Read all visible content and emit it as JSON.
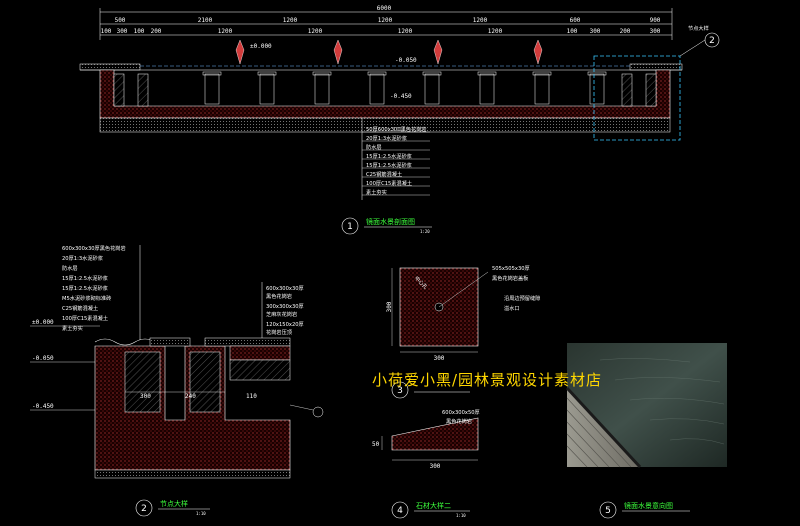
{
  "colors": {
    "background": "#000000",
    "line": "#ffffff",
    "title": "#3cff3c",
    "watermark": "#ffd700",
    "hatch": "#d23c3c",
    "highlight": "#38c8ff"
  },
  "section1": {
    "total_dim": "6000",
    "top_dims": [
      "500",
      "2100",
      "1200",
      "1200",
      "1200",
      "600",
      "900"
    ],
    "detail_dims": [
      "100",
      "300",
      "100",
      "200",
      "1200",
      "1200",
      "1200",
      "1200",
      "100",
      "300",
      "200",
      "300"
    ],
    "level_label": "±0.000",
    "level_label_2": "-0.050",
    "level_label_3": "-0.450",
    "callout_detail_num": "2",
    "callout_detail_label": "节点大样",
    "layers": [
      "50厚600x300黑色花岗岩",
      "20厚1:3水泥砂浆",
      "防水层",
      "15厚1:2.5水泥砂浆",
      "15厚1:2.5水泥砂浆",
      "C25钢筋混凝土",
      "100厚C15素混凝土",
      "素土夯实"
    ],
    "title_num": "1",
    "title": "镜面水景剖面图",
    "scale": "1:20"
  },
  "section2": {
    "layers": [
      "600x300x30厚黑色花岗岩",
      "20厚1:3水泥砂浆",
      "防水层",
      "15厚1:2.5水泥砂浆",
      "15厚1:2.5水泥砂浆",
      "M5水泥砂浆砌标准砖",
      "C25钢筋混凝土",
      "100厚C15素混凝土",
      "素土夯实"
    ],
    "right_notes": [
      "600x300x30厚",
      "黑色花岗岩",
      "300x300x30厚",
      "芝麻灰花岗岩",
      "120x150x20厚",
      "花岗岩压顶"
    ],
    "level_a": "±0.000",
    "level_b": "-0.050",
    "level_c": "-0.450",
    "bottom_dims": [
      "300",
      "240",
      "110"
    ],
    "title_num": "2",
    "title": "节点大样",
    "scale": "1:10"
  },
  "section3": {
    "dim_w": "300",
    "dim_h": "300",
    "center_label": "中心孔",
    "notes": [
      "505x505x30厚",
      "黑色花岗岩盖板",
      "沿周边预留缝隙",
      "溢水口"
    ],
    "title_num": "3"
  },
  "section4": {
    "top_note": "600x300x50厚",
    "note_2": "黑色花岗岩",
    "bottom_dim": "300",
    "side_dim": "50",
    "title_num": "4",
    "title": "石材大样二",
    "scale": "1:10"
  },
  "section5": {
    "title_num": "5",
    "title": "镜面水景意向图"
  },
  "watermark": "小荷爱小黑/园林景观设计素材店"
}
